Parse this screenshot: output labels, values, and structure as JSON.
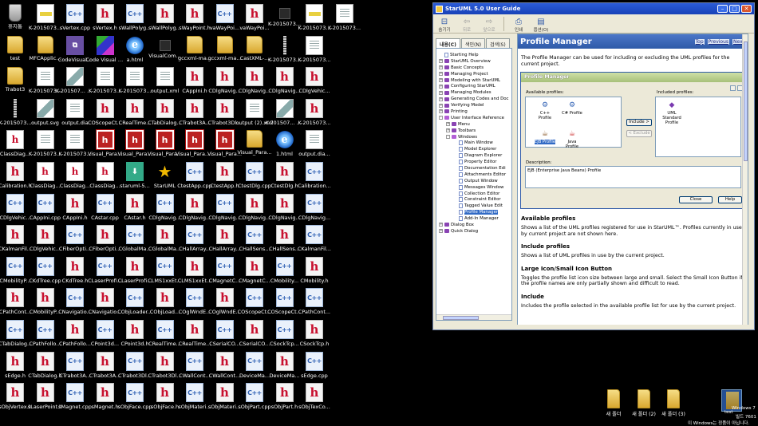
{
  "desktop": {
    "icons": [
      {
        "label": "휴지통",
        "type": "trash"
      },
      {
        "label": "test",
        "type": "folder"
      },
      {
        "label": "Trabot3",
        "type": "folder"
      },
      {
        "label": "K-2015073...",
        "type": "file"
      },
      {
        "label": "ClassDiag...",
        "type": "ovr"
      },
      {
        "label": "Calibration.h",
        "type": "h"
      },
      {
        "label": "CDlgVehic...",
        "type": "cpp"
      },
      {
        "label": "CKalmanFil...",
        "type": "h"
      },
      {
        "label": "CMobilityP...",
        "type": "cpp"
      },
      {
        "label": "CPathCont...",
        "type": "h"
      },
      {
        "label": "CTabDialog...",
        "type": "cpp"
      },
      {
        "label": "sEdge.h",
        "type": "h"
      },
      {
        "label": "sObjVertex.h",
        "type": "h"
      },
      {
        "label": "K-2015073...",
        "type": "bmp"
      },
      {
        "label": "MFCApplic...",
        "type": "folder"
      },
      {
        "label": "K-2015073...",
        "type": "doc"
      },
      {
        "label": "output.svg",
        "type": "img"
      },
      {
        "label": "K-2015073...",
        "type": "doc"
      },
      {
        "label": "ClassDiag...",
        "type": "ovr"
      },
      {
        "label": "CAppIni.cpp",
        "type": "cpp"
      },
      {
        "label": "CDlgVehic...",
        "type": "h"
      },
      {
        "label": "CKdTree.cpp",
        "type": "cpp"
      },
      {
        "label": "CMobilityP...",
        "type": "h"
      },
      {
        "label": "CPathFollo...",
        "type": "cpp"
      },
      {
        "label": "CTabDialog.h",
        "type": "h"
      },
      {
        "label": "sLaserPoint.h",
        "type": "h"
      },
      {
        "label": "sVertex.cpp",
        "type": "cpp"
      },
      {
        "label": "CodeVisual...",
        "type": "vs"
      },
      {
        "label": "K-201507... (2).png",
        "type": "img"
      },
      {
        "label": "output.dia",
        "type": "doc"
      },
      {
        "label": "K-2015073...",
        "type": "doc"
      },
      {
        "label": "ClassDiag...",
        "type": "ovr"
      },
      {
        "label": "CAppIni.h",
        "type": "h"
      },
      {
        "label": "CFiberOpti...",
        "type": "cpp"
      },
      {
        "label": "CKdTree.h",
        "type": "h"
      },
      {
        "label": "CNavigatio...",
        "type": "cpp"
      },
      {
        "label": "CPathFollo...",
        "type": "h"
      },
      {
        "label": "CTrabot3A...",
        "type": "cpp"
      },
      {
        "label": "sMagnet.cpp",
        "type": "cpp"
      },
      {
        "label": "sVertex.h",
        "type": "h"
      },
      {
        "label": "Code Visual to Flowchart",
        "type": "flow"
      },
      {
        "label": "K-2015073...",
        "type": "doc"
      },
      {
        "label": "COScopeCt...",
        "type": "h"
      },
      {
        "label": "Visual_Para...",
        "type": "vsp"
      },
      {
        "label": "ClassDiag...",
        "type": "ovr"
      },
      {
        "label": "CAstar.cpp",
        "type": "cpp"
      },
      {
        "label": "CFiberOpti...",
        "type": "h"
      },
      {
        "label": "CLaserProfi...",
        "type": "cpp"
      },
      {
        "label": "CNavigatio...",
        "type": "h"
      },
      {
        "label": "CPoint3d...",
        "type": "cpp"
      },
      {
        "label": "CTrabot3A...",
        "type": "h"
      },
      {
        "label": "sMagnet.h",
        "type": "h"
      },
      {
        "label": "sWallPolyg...",
        "type": "cpp"
      },
      {
        "label": "a.html",
        "type": "ie"
      },
      {
        "label": "K-2015073...",
        "type": "doc"
      },
      {
        "label": "CRealTime...",
        "type": "h"
      },
      {
        "label": "Visual_Para...",
        "type": "vsp"
      },
      {
        "label": "staruml-5...",
        "type": "setup"
      },
      {
        "label": "CAstar.h",
        "type": "h"
      },
      {
        "label": "CGlobalMa...",
        "type": "cpp"
      },
      {
        "label": "CLaserProfi...",
        "type": "h"
      },
      {
        "label": "CObjLoader...",
        "type": "cpp"
      },
      {
        "label": "CPoint3d.h",
        "type": "h"
      },
      {
        "label": "CTrabot3Dl...",
        "type": "cpp"
      },
      {
        "label": "sObjFace.cpp",
        "type": "cpp"
      },
      {
        "label": "sWallPolyg...",
        "type": "h"
      },
      {
        "label": "VisualCom...",
        "type": "blank"
      },
      {
        "label": "output.xml",
        "type": "doc"
      },
      {
        "label": "CTabDialog...",
        "type": "h"
      },
      {
        "label": "Visual_Para...",
        "type": "vsp"
      },
      {
        "label": "StarUML",
        "type": "star"
      },
      {
        "label": "CDlgNavig...",
        "type": "cpp"
      },
      {
        "label": "CGlobalMa...",
        "type": "h"
      },
      {
        "label": "CLMS1xxEt...",
        "type": "cpp"
      },
      {
        "label": "CObjLoad...",
        "type": "h"
      },
      {
        "label": "CRealTime...",
        "type": "cpp"
      },
      {
        "label": "CTrabot3Dl...",
        "type": "h"
      },
      {
        "label": "sObjFace.h",
        "type": "h"
      },
      {
        "label": "sWayPoint.h",
        "type": "h"
      },
      {
        "label": "gccxml-ma...",
        "type": "folder"
      },
      {
        "label": "CAppIni.h",
        "type": "h"
      },
      {
        "label": "CTrabot3A...",
        "type": "h"
      },
      {
        "label": "Visual_Para... (1).exe",
        "type": "vsp"
      },
      {
        "label": "CtestApp.cpp",
        "type": "cpp"
      },
      {
        "label": "CDlgNavig...",
        "type": "h"
      },
      {
        "label": "CHallArray...",
        "type": "cpp"
      },
      {
        "label": "CLMS1xxEt...",
        "type": "h"
      },
      {
        "label": "COglWndE...",
        "type": "cpp"
      },
      {
        "label": "CRealTime...",
        "type": "h"
      },
      {
        "label": "CWallCont...",
        "type": "cpp"
      },
      {
        "label": "sObjMateri...",
        "type": "cpp"
      },
      {
        "label": "vaWayPoi...",
        "type": "cpp"
      },
      {
        "label": "gccxml-ma...",
        "type": "folder"
      },
      {
        "label": "CDlgNavig...",
        "type": "h"
      },
      {
        "label": "CTrabot3Dl...",
        "type": "h"
      },
      {
        "label": "Visual_Para...",
        "type": "vsp"
      },
      {
        "label": "CtestApp.h",
        "type": "h"
      },
      {
        "label": "CDlgNavig...",
        "type": "cpp"
      },
      {
        "label": "CHallArray...",
        "type": "h"
      },
      {
        "label": "CMagnetC...",
        "type": "cpp"
      },
      {
        "label": "COglWndE...",
        "type": "h"
      },
      {
        "label": "CSerialCO...",
        "type": "cpp"
      },
      {
        "label": "CWallCont...",
        "type": "h"
      },
      {
        "label": "sObjMateri...",
        "type": "h"
      },
      {
        "label": "vaWayPoi...",
        "type": "h"
      },
      {
        "label": "CastXML-...",
        "type": "folder"
      },
      {
        "label": "CDlgNavig...",
        "type": "h"
      },
      {
        "label": "output (2).xml",
        "type": "doc"
      },
      {
        "label": "Visual_Para...",
        "type": "folder"
      },
      {
        "label": "CtestDlg.cpp",
        "type": "cpp"
      },
      {
        "label": "CDlgNavig...",
        "type": "h"
      },
      {
        "label": "CHallSens...",
        "type": "cpp"
      },
      {
        "label": "CMagnetC...",
        "type": "h"
      },
      {
        "label": "COScopeCt...",
        "type": "cpp"
      },
      {
        "label": "CSerialCO...",
        "type": "h"
      },
      {
        "label": "DeviceMa...",
        "type": "cpp"
      },
      {
        "label": "sObjPart.cpp",
        "type": "cpp"
      },
      {
        "label": "K-2015073...",
        "type": "blank"
      },
      {
        "label": "K-2015073...",
        "type": "file"
      },
      {
        "label": "CDlgNavig...",
        "type": "h"
      },
      {
        "label": "K-201507... (2).png",
        "type": "img"
      },
      {
        "label": "1.html",
        "type": "ie"
      },
      {
        "label": "CtestDlg.h",
        "type": "h"
      },
      {
        "label": "CDlgNavig...",
        "type": "h"
      },
      {
        "label": "CHallSens...",
        "type": "h"
      },
      {
        "label": "CMobility...",
        "type": "cpp"
      },
      {
        "label": "COScopeCt...",
        "type": "cpp"
      },
      {
        "label": "CSockTcp...",
        "type": "cpp"
      },
      {
        "label": "DeviceMa...",
        "type": "h"
      },
      {
        "label": "sObjPart.h",
        "type": "h"
      },
      {
        "label": "K-2015073...",
        "type": "bmp"
      },
      {
        "label": "K-2015073...",
        "type": "doc"
      },
      {
        "label": "CDlgVehic...",
        "type": "h"
      },
      {
        "label": "K-2015073...",
        "type": "h"
      },
      {
        "label": "output.dia...",
        "type": "doc"
      },
      {
        "label": "Calibration...",
        "type": "cpp"
      },
      {
        "label": "CDlgNavig...",
        "type": "cpp"
      },
      {
        "label": "CKalmanFil...",
        "type": "cpp"
      },
      {
        "label": "CMobility.h",
        "type": "h"
      },
      {
        "label": "CPathCont...",
        "type": "cpp"
      },
      {
        "label": "CSockTcp.h",
        "type": "h"
      },
      {
        "label": "sEdge.cpp",
        "type": "cpp"
      },
      {
        "label": "sObjTexCo...",
        "type": "h"
      },
      {
        "label": "K-2015073...",
        "type": "doc"
      }
    ]
  },
  "helpwin": {
    "title": "StarUML 5.0 User Guide",
    "toolbar": [
      {
        "label": "숨기기",
        "icon": "hide-icon",
        "glyph": "⊟",
        "enabled": true
      },
      {
        "label": "뒤로",
        "icon": "back-icon",
        "glyph": "⇦",
        "enabled": false
      },
      {
        "label": "앞으로",
        "icon": "forward-icon",
        "glyph": "⇨",
        "enabled": false
      },
      {
        "label": "인쇄",
        "icon": "print-icon",
        "glyph": "⎙",
        "enabled": true
      },
      {
        "label": "옵션(O)",
        "icon": "options-icon",
        "glyph": "▤",
        "enabled": true
      }
    ],
    "tabs": [
      "내용(C)",
      "색인(N)",
      "검색(S)"
    ],
    "tree": [
      {
        "label": "Starting Help",
        "level": 0,
        "kind": "page",
        "exp": ""
      },
      {
        "label": "StarUML Overview",
        "level": 0,
        "kind": "book",
        "exp": "+"
      },
      {
        "label": "Basic Concepts",
        "level": 0,
        "kind": "book",
        "exp": "+"
      },
      {
        "label": "Managing Project",
        "level": 0,
        "kind": "book",
        "exp": "+"
      },
      {
        "label": "Modeling with StarUML",
        "level": 0,
        "kind": "book",
        "exp": "+"
      },
      {
        "label": "Configuring StarUML",
        "level": 0,
        "kind": "book",
        "exp": "+"
      },
      {
        "label": "Managing Modules",
        "level": 0,
        "kind": "book",
        "exp": "+"
      },
      {
        "label": "Generating Codes and Doc",
        "level": 0,
        "kind": "book",
        "exp": "+"
      },
      {
        "label": "Verifying Model",
        "level": 0,
        "kind": "book",
        "exp": "+"
      },
      {
        "label": "Printing",
        "level": 0,
        "kind": "book",
        "exp": "+"
      },
      {
        "label": "User Interface Reference",
        "level": 0,
        "kind": "bookopen",
        "exp": "-"
      },
      {
        "label": "Menu",
        "level": 1,
        "kind": "book",
        "exp": "+"
      },
      {
        "label": "Toolbars",
        "level": 1,
        "kind": "book",
        "exp": "+"
      },
      {
        "label": "Windows",
        "level": 1,
        "kind": "bookopen",
        "exp": "-"
      },
      {
        "label": "Main Window",
        "level": 2,
        "kind": "page",
        "exp": ""
      },
      {
        "label": "Model Explorer",
        "level": 2,
        "kind": "page",
        "exp": ""
      },
      {
        "label": "Diagram Explorer",
        "level": 2,
        "kind": "page",
        "exp": ""
      },
      {
        "label": "Property Editor",
        "level": 2,
        "kind": "page",
        "exp": ""
      },
      {
        "label": "Documentation Edi",
        "level": 2,
        "kind": "page",
        "exp": ""
      },
      {
        "label": "Attachments Editor",
        "level": 2,
        "kind": "page",
        "exp": ""
      },
      {
        "label": "Output Window",
        "level": 2,
        "kind": "page",
        "exp": ""
      },
      {
        "label": "Messages Window",
        "level": 2,
        "kind": "page",
        "exp": ""
      },
      {
        "label": "Collection Editor",
        "level": 2,
        "kind": "page",
        "exp": ""
      },
      {
        "label": "Constraint Editor",
        "level": 2,
        "kind": "page",
        "exp": ""
      },
      {
        "label": "Tagged Value Edit",
        "level": 2,
        "kind": "page",
        "exp": ""
      },
      {
        "label": "Profile Manager",
        "level": 2,
        "kind": "page",
        "exp": "",
        "selected": true
      },
      {
        "label": "Add-In Manager",
        "level": 2,
        "kind": "page",
        "exp": ""
      },
      {
        "label": "Dialog Box",
        "level": 0,
        "kind": "book",
        "exp": "+"
      },
      {
        "label": "Quick Dialog",
        "level": 0,
        "kind": "book",
        "exp": "+"
      }
    ],
    "topic": {
      "title": "Profile Manager",
      "links": [
        "Top",
        "Previous",
        "Next"
      ],
      "intro": "The Profile Manager can be used for including or excluding the UML profiles for the current project.",
      "dialog": {
        "title": "Profile Manager",
        "available_label": "Available profiles:",
        "included_label": "Included profiles:",
        "available": [
          {
            "label": "C++ Profile",
            "icon": "cpp-profile-icon",
            "glyph": "⚙",
            "color": "#2d5fb3"
          },
          {
            "label": "C# Profile",
            "icon": "csharp-profile-icon",
            "glyph": "⚙",
            "color": "#2d5fb3"
          },
          {
            "label": "EJB Profile",
            "icon": "ejb-profile-icon",
            "glyph": "☕",
            "color": "#8a5a2a",
            "selected": true
          },
          {
            "label": "Java Profile",
            "icon": "java-profile-icon",
            "glyph": "☕",
            "color": "#c33"
          }
        ],
        "included": [
          {
            "label": "UML Standard Profile",
            "icon": "uml-standard-profile-icon",
            "glyph": "◆",
            "color": "#7a3ab0"
          }
        ],
        "include_btn": "Include >",
        "exclude_btn": "< Exclude",
        "desc_label": "Description:",
        "desc_text": "EJB (Enterprise Java Beans) Profile",
        "close_btn": "Close",
        "help_btn": "Help"
      },
      "sections": [
        {
          "head": "Available profiles",
          "text": "Shows a list of the UML profiles registered for use in StarUML™. Profiles currently in use by current project are not shown here."
        },
        {
          "head": "Include profiles",
          "text": "Shows a list of UML profiles in use by the current project."
        },
        {
          "head": "Large Icon/Small Icon Button",
          "text": "Toggles the profile list icon size between large and small. Select the Small Icon Button if the profile names are only partially shown and difficult to read."
        },
        {
          "head": "Include",
          "text": "Includes the profile selected in the available profile list for use by the current project."
        }
      ]
    }
  },
  "newfolders": [
    "새 폴더",
    "새 폴더 (2)",
    "새 폴더 (3)"
  ],
  "tray": {
    "selected_label": "test",
    "line1": "Windows 7",
    "line2": "빌드 7601",
    "line3": "이 Windows는 정품이 아닙니다."
  }
}
